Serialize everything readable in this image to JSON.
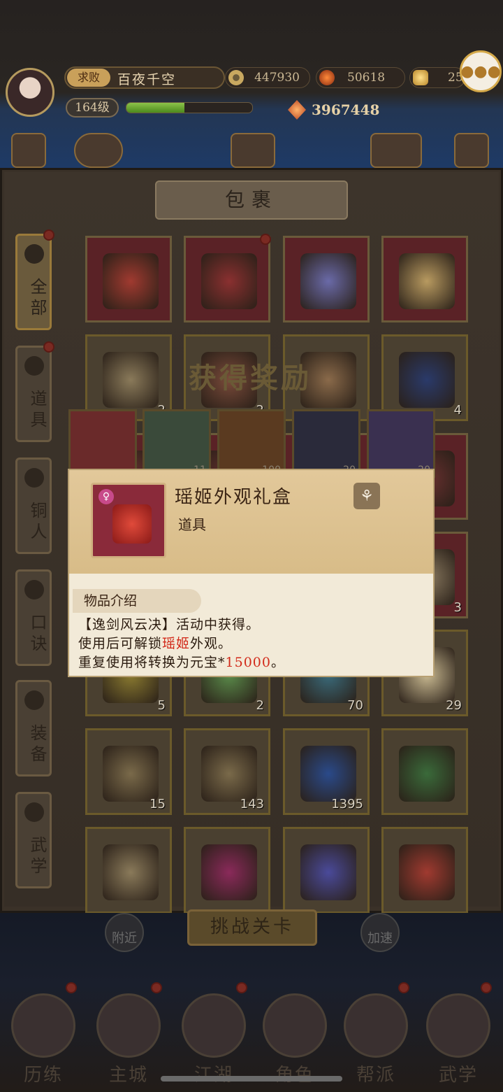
{
  "player": {
    "title_badge": "求败",
    "name": "百夜千空",
    "level": "164级",
    "xp_fraction": 0.46,
    "power": "3967448"
  },
  "resources": [
    {
      "name": "copper-coin",
      "value": "447930"
    },
    {
      "name": "fire-token",
      "value": "50618"
    },
    {
      "name": "gold-ingot",
      "value": "25"
    }
  ],
  "bag": {
    "title": "包裹",
    "tabs": [
      {
        "label": "全部",
        "active": true
      },
      {
        "label": "道具"
      },
      {
        "label": "铜人"
      },
      {
        "label": "口诀"
      },
      {
        "label": "装备"
      },
      {
        "label": "武学"
      }
    ],
    "rows": [
      [
        {
          "count": ""
        },
        {
          "count": ""
        },
        {
          "count": ""
        },
        {
          "count": ""
        }
      ],
      [
        {
          "count": "2"
        },
        {
          "count": "2"
        },
        {
          "count": ""
        },
        {
          "count": "4"
        }
      ],
      [
        {
          "count": ""
        },
        {
          "count": ""
        },
        {
          "count": ""
        },
        {
          "count": ""
        }
      ],
      [
        {
          "count": ""
        },
        {
          "count": ""
        },
        {
          "count": ""
        },
        {
          "count": "3"
        }
      ],
      [
        {
          "count": "5"
        },
        {
          "count": "2"
        },
        {
          "count": "70"
        },
        {
          "count": "29"
        }
      ],
      [
        {
          "count": "15"
        },
        {
          "count": "143"
        },
        {
          "count": "1395"
        },
        {
          "count": ""
        }
      ],
      [
        {
          "count": ""
        },
        {
          "count": ""
        },
        {
          "count": ""
        },
        {
          "count": ""
        }
      ]
    ]
  },
  "reward": {
    "title": "获得奖励",
    "items": [
      {
        "count": ""
      },
      {
        "count": "11"
      },
      {
        "count": "100"
      },
      {
        "count": "20"
      },
      {
        "count": "20"
      }
    ]
  },
  "tooltip": {
    "item_name": "瑶姬外观礼盒",
    "item_type": "道具",
    "section_title": "物品介绍",
    "line1": "【逸剑风云决】活动中获得。",
    "line2_a": "使用后可解锁",
    "line2_highlight": "瑶姬",
    "line2_b": "外观。",
    "line3_a": "重复使用将转换为元宝",
    "line3_star": "*",
    "line3_highlight": "15000",
    "line3_b": "。"
  },
  "bottom": {
    "challenge_label": "挑战关卡",
    "nearby_label": "附近",
    "speedup_label": "加速",
    "nav": [
      "历练",
      "主城",
      "江湖",
      "角色",
      "帮派",
      "武学"
    ]
  },
  "colors": {
    "highlight_red": "#d22a1a",
    "popup_bg": "#f2ead8",
    "accent_gold": "#d4a94a"
  }
}
